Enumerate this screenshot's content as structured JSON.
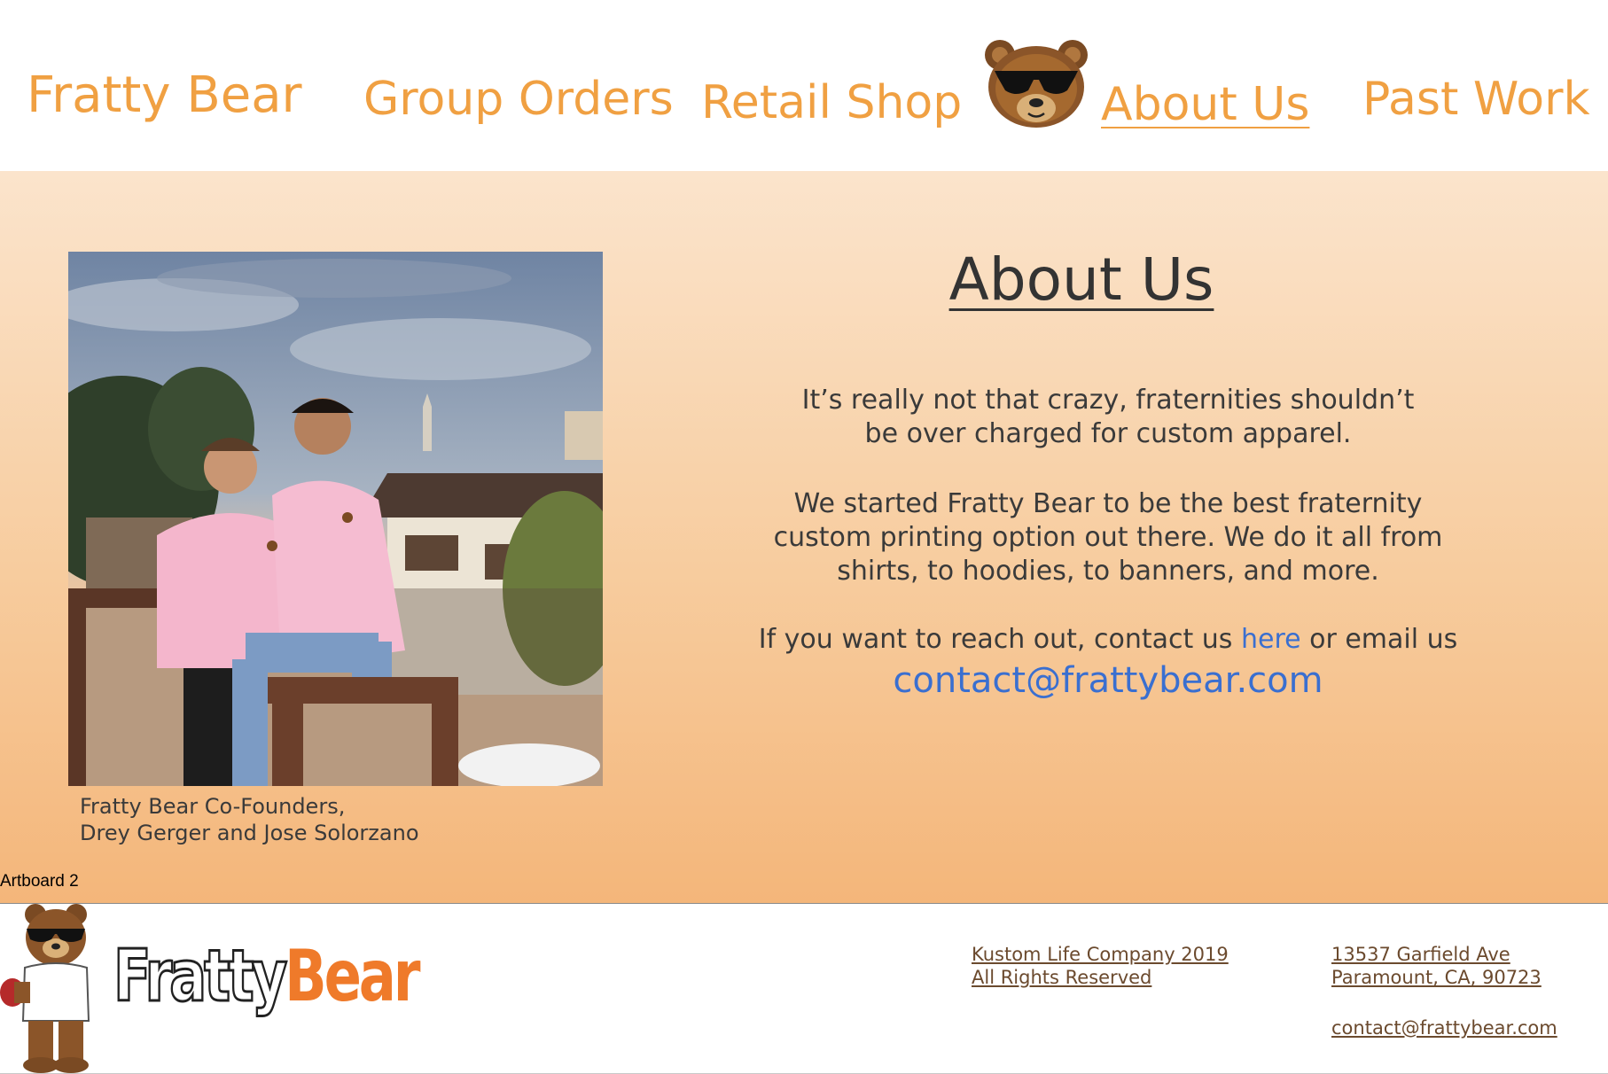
{
  "nav": {
    "brand": "Fratty Bear",
    "group_orders": "Group Orders",
    "retail_shop": "Retail Shop",
    "about_us": "About Us",
    "past_work": "Past Work",
    "logo_icon": "bear-sunglasses-icon"
  },
  "main": {
    "photo": {
      "icon": "cofounders-photo"
    },
    "caption": {
      "line1": "Fratty Bear Co-Founders,",
      "line2": "Drey Gerger and Jose Solorzano"
    },
    "title": "About Us",
    "paragraph1": {
      "line1": "It’s really not that crazy, fraternities shouldn’t",
      "line2": "be over charged for custom apparel."
    },
    "paragraph2": {
      "line1": "We started Fratty Bear to be the best fraternity",
      "line2": "custom printing option out there. We do it all from",
      "line3": "shirts, to hoodies, to banners, and more."
    },
    "paragraph3": {
      "before_link": "If you want to reach out, contact us ",
      "link": "here",
      "after_link": " or email us"
    },
    "email": "contact@frattybear.com",
    "artboard_label": "Artboard 2"
  },
  "footer": {
    "logo_part1": "Fratty",
    "logo_part2": "Bear",
    "mascot_icon": "bear-mascot-icon",
    "copyright_line1": "Kustom Life Company 2019",
    "copyright_line2": "All Rights Reserved",
    "address_line1": "13537 Garfield Ave",
    "address_line2": "Paramount, CA, 90723",
    "email": "contact@frattybear.com"
  },
  "colors": {
    "nav_orange": "#f0a042",
    "link_blue": "#3a6fd0",
    "logo_orange": "#ef7a2a",
    "gradient_top": "#fbe4cc",
    "gradient_bottom": "#f4b67a"
  }
}
